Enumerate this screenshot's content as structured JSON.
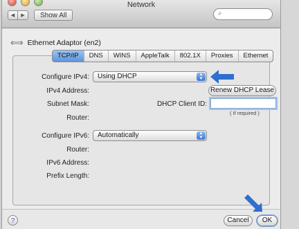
{
  "window": {
    "title": "Network"
  },
  "toolbar": {
    "show_all_label": "Show All",
    "search_placeholder": ""
  },
  "adaptor": {
    "label": "Ethernet Adaptor (en2)"
  },
  "tabs": [
    "TCP/IP",
    "DNS",
    "WINS",
    "AppleTalk",
    "802.1X",
    "Proxies",
    "Ethernet"
  ],
  "active_tab": "TCP/IP",
  "ipv4": {
    "configure_label": "Configure IPv4:",
    "configure_value": "Using DHCP",
    "address_label": "IPv4 Address:",
    "subnet_label": "Subnet Mask:",
    "router_label": "Router:",
    "renew_button": "Renew DHCP Lease",
    "client_id_label": "DHCP Client ID:",
    "client_id_value": "",
    "client_id_hint": "( If required )"
  },
  "ipv6": {
    "configure_label": "Configure IPv6:",
    "configure_value": "Automatically",
    "router_label": "Router:",
    "address_label": "IPv6 Address:",
    "prefix_label": "Prefix Length:"
  },
  "footer": {
    "cancel_label": "Cancel",
    "ok_label": "OK",
    "help_glyph": "?"
  },
  "colors": {
    "accent": "#3f78d4",
    "arrow": "#2f6fcf"
  }
}
